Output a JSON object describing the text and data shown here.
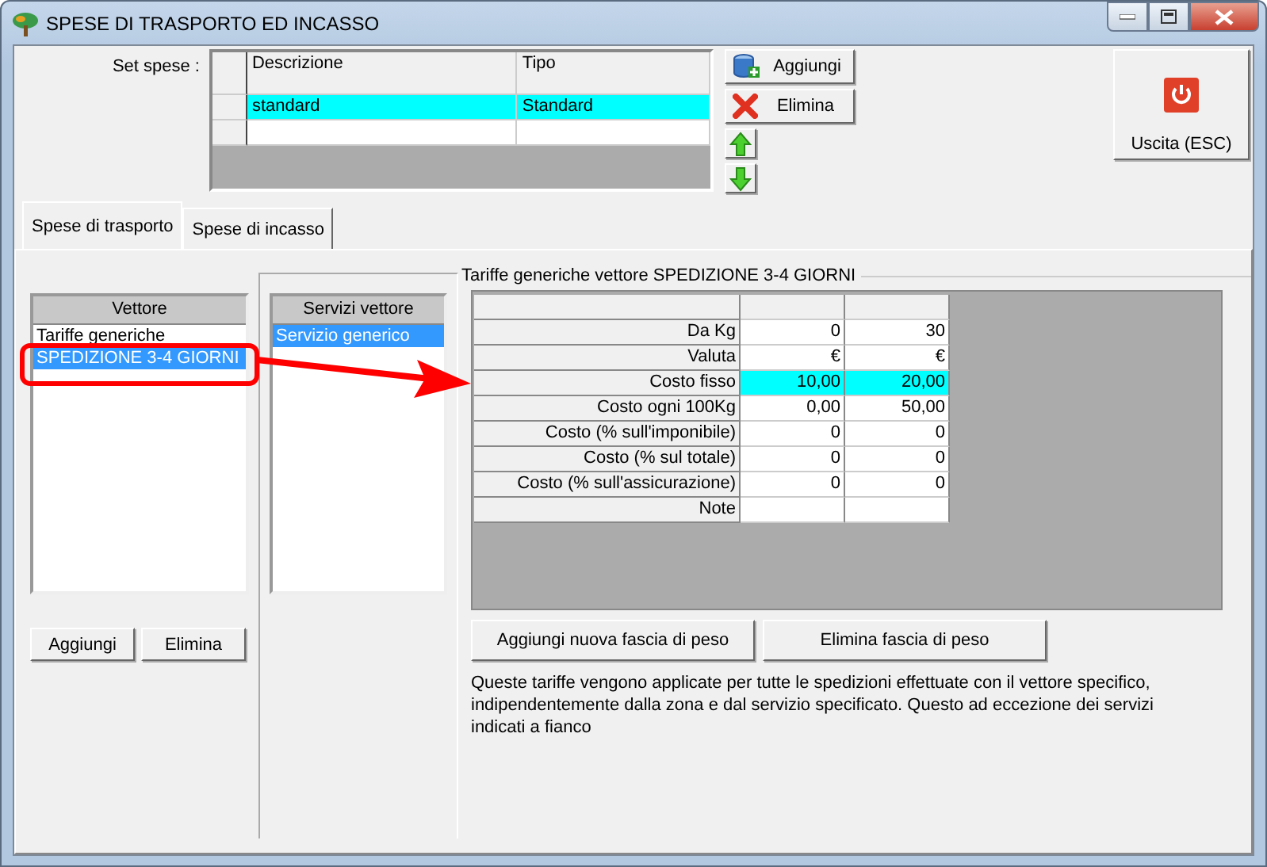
{
  "window": {
    "title": "SPESE DI TRASPORTO ED INCASSO"
  },
  "set_spese": {
    "label": "Set spese :",
    "columns": [
      "Descrizione",
      "Tipo"
    ],
    "rows": [
      {
        "cells": [
          "standard",
          "Standard"
        ],
        "selected": true
      }
    ]
  },
  "set_buttons": [
    {
      "label": "Aggiungi"
    },
    {
      "label": "Elimina"
    }
  ],
  "exit_button": {
    "label": "Uscita (ESC)"
  },
  "tabs": [
    {
      "label": "Spese di trasporto",
      "selected": true
    },
    {
      "label": "Spese di incasso",
      "selected": false
    }
  ],
  "vettore": {
    "header": "Vettore",
    "items": [
      {
        "label": "Tariffe generiche",
        "selected": false
      },
      {
        "label": "SPEDIZIONE 3-4 GIORNI",
        "selected": true
      }
    ],
    "buttons": [
      "Aggiungi",
      "Elimina"
    ]
  },
  "servizi": {
    "header": "Servizi vettore",
    "items": [
      {
        "label": "Servizio generico",
        "selected": true
      }
    ]
  },
  "tariffe": {
    "title": "Tariffe generiche vettore SPEDIZIONE 3-4 GIORNI",
    "rows": [
      {
        "label": "Da Kg",
        "values": [
          "0",
          "30"
        ],
        "selected": false
      },
      {
        "label": "Valuta",
        "values": [
          "€",
          "€"
        ],
        "selected": false
      },
      {
        "label": "Costo fisso",
        "values": [
          "10,00",
          "20,00"
        ],
        "selected": true
      },
      {
        "label": "Costo ogni 100Kg",
        "values": [
          "0,00",
          "50,00"
        ],
        "selected": false
      },
      {
        "label": "Costo (% sull'imponibile)",
        "values": [
          "0",
          "0"
        ],
        "selected": false
      },
      {
        "label": "Costo (% sul totale)",
        "values": [
          "0",
          "0"
        ],
        "selected": false
      },
      {
        "label": "Costo (% sull'assicurazione)",
        "values": [
          "0",
          "0"
        ],
        "selected": false
      },
      {
        "label": "Note",
        "values": [],
        "selected": false
      }
    ],
    "buttons": [
      "Aggiungi nuova fascia di peso",
      "Elimina fascia di peso"
    ],
    "note": "Queste tariffe vengono applicate per tutte le spedizioni effettuate con il vettore specifico, indipendentemente dalla zona e dal servizio specificato. Questo ad eccezione dei servizi indicati a fianco"
  }
}
